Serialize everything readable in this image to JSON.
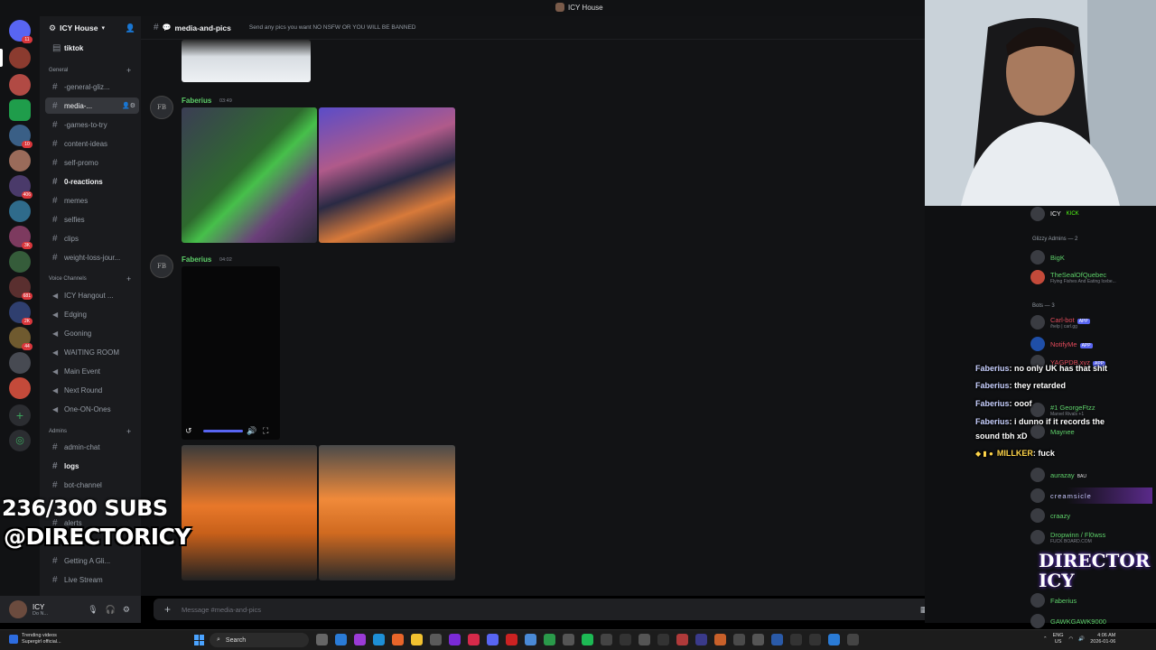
{
  "window": {
    "title": "ICY House"
  },
  "server": {
    "name": "ICY House"
  },
  "channels": {
    "top": [
      {
        "label": "tiktok"
      }
    ],
    "general_category": "General",
    "general": [
      {
        "label": "-general-gliz..."
      },
      {
        "label": "media-..."
      },
      {
        "label": "-games-to-try"
      },
      {
        "label": "content-ideas"
      },
      {
        "label": "self-promo"
      },
      {
        "label": "0-reactions"
      },
      {
        "label": "memes"
      },
      {
        "label": "selfies"
      },
      {
        "label": "clips"
      },
      {
        "label": "weight-loss-jour..."
      }
    ],
    "voice_category": "Voice Channels",
    "voice": [
      {
        "label": "ICY Hangout ..."
      },
      {
        "label": "Edging"
      },
      {
        "label": "Gooning"
      },
      {
        "label": "WAITING ROOM"
      },
      {
        "label": "Main Event"
      },
      {
        "label": "Next Round"
      },
      {
        "label": "One-ON-Ones"
      }
    ],
    "admins_category": "Admins",
    "admins": [
      {
        "label": "admin-chat"
      },
      {
        "label": "logs"
      },
      {
        "label": "bot-channel"
      },
      {
        "label": "alerts"
      },
      {
        "label": "Getting A Gli..."
      },
      {
        "label": "Live Stream"
      }
    ]
  },
  "user": {
    "name": "ICY",
    "status": "Do N..."
  },
  "channel_header": {
    "name": "media-and-pics",
    "topic": "Send any pics you want NO NSFW OR YOU WILL BE BANNED"
  },
  "messages": [
    {
      "author": "Faberius",
      "time": "03:49"
    },
    {
      "author": "Faberius",
      "time": "04:02"
    }
  ],
  "composer": {
    "placeholder": "Message #media-and-pics"
  },
  "members": {
    "top": {
      "name": "ICY",
      "tag": "KICK"
    },
    "admins_header": "Glizzy Admins — 2",
    "admins": [
      {
        "name": "BigK"
      },
      {
        "name": "TheSealOfQuebec",
        "sub": "Flying Fishes And Eating Icebe..."
      }
    ],
    "bots_header": "Bots — 3",
    "bots": [
      {
        "name": "Carl-bot",
        "tag": "APP",
        "sub": "/help | carl.gg"
      },
      {
        "name": "NotifyMe",
        "tag": "APP"
      },
      {
        "name": "YAGPDB.xyz",
        "tag": "APP"
      }
    ],
    "more": [
      {
        "name": "#1 GeorgeFtzz",
        "sub": "Marvel Rivals +1"
      },
      {
        "name": "Maynee"
      },
      {
        "name": "aurazay",
        "tag": "BAU"
      },
      {
        "name": "creamsicle"
      },
      {
        "name": "craazy"
      },
      {
        "name": "Dropwinn / Fl0wss",
        "sub": "FUCK BOARD.COM"
      },
      {
        "name": "Faberius"
      },
      {
        "name": "GAWKGAWK9000"
      }
    ]
  },
  "overlay": {
    "subs": "236/300 SUBS",
    "handle": "@DIRECTORICY",
    "chat": [
      {
        "who": "Faberius",
        "text": ": no only UK has that shit"
      },
      {
        "who": "Faberius",
        "text": ": they retarded"
      },
      {
        "who": "Faberius",
        "text": ": ooof"
      },
      {
        "who": "Faberius",
        "text": ": i dunno if it records the"
      },
      {
        "who": "",
        "text": "sound tbh xD"
      },
      {
        "who": "MILLKER",
        "text": ": fuck"
      }
    ],
    "logo_text": "DIRECTOR ICY"
  },
  "taskbar": {
    "news_title": "Trending videos",
    "news_sub": "Supergirl official...",
    "search": "Search",
    "lang": "ENG",
    "region": "US",
    "time": "4:06 AM",
    "date": "2026-01-06"
  },
  "colors": {
    "accent": "#5865f2",
    "username_green": "#5ed16a",
    "bg_main": "#121315"
  }
}
